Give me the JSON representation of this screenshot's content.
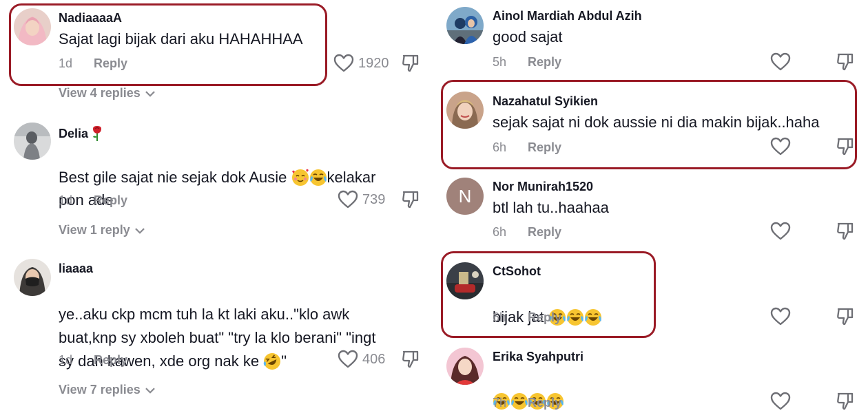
{
  "left": {
    "comments": [
      {
        "username": "NadiaaaaA",
        "text": "Sajat lagi bijak dari aku HAHAHHAA",
        "time": "1d",
        "reply": "Reply",
        "likes": "1920",
        "view_replies": "View 4 replies",
        "avatar": "woman-hijab-pink"
      },
      {
        "username": "Delia",
        "name_emoji": "rose-emoji",
        "text": "Best gile sajat nie sejak dok Ausie",
        "text_emojis": [
          "smiling-face-with-hearts-emoji",
          "tears-of-joy-emoji"
        ],
        "text_after": "kelakar",
        "text_line2": "pon ade",
        "time": "1d",
        "reply": "Reply",
        "likes": "739",
        "view_replies": "View 1 reply",
        "avatar": "woman-gray"
      },
      {
        "username": "liaaaa",
        "text_line1": "ye..aku ckp mcm tuh la kt laki aku..\"klo awk",
        "text_line2": "buat,knp sy xboleh buat\" \"try la klo berani\" \"ingt",
        "text_line3": "sy dah kawen, xde org nak ke",
        "text_emoji": "rolling-laughing-emoji",
        "text_end": "\"",
        "time": "1d",
        "reply": "Reply",
        "likes": "406",
        "view_replies": "View 7 replies",
        "avatar": "woman-mask"
      }
    ]
  },
  "right": {
    "comments": [
      {
        "username": "Ainol Mardiah Abdul Azih",
        "text": "good sajat",
        "time": "5h",
        "reply": "Reply",
        "avatar": "family-photo"
      },
      {
        "username": "Nazahatul Syikien",
        "text": "sejak sajat ni dok aussie ni dia makin bijak..haha",
        "time": "6h",
        "reply": "Reply",
        "avatar": "woman-smile"
      },
      {
        "username": "Nor Munirah1520",
        "text": "btl lah tu..haahaa",
        "time": "6h",
        "reply": "Reply",
        "avatar": "initial-N",
        "initial": "N"
      },
      {
        "username": "CtSohot",
        "text": "bijak jat",
        "text_emojis": [
          "tears-of-joy-emoji",
          "tears-of-joy-emoji",
          "tears-of-joy-emoji"
        ],
        "time": "6h",
        "reply": "Reply",
        "avatar": "car-photo"
      },
      {
        "username": "Erika Syahputri",
        "text_emojis": [
          "tears-of-joy-emoji",
          "tears-of-joy-emoji",
          "tears-of-joy-emoji",
          "tears-of-joy-emoji"
        ],
        "time": "7h",
        "reply": "Reply",
        "avatar": "woman-red"
      }
    ]
  },
  "colors": {
    "highlight": "#9a1b26",
    "meta": "#8a8b91",
    "text": "#161823",
    "initial_avatar": "#a0827a"
  }
}
